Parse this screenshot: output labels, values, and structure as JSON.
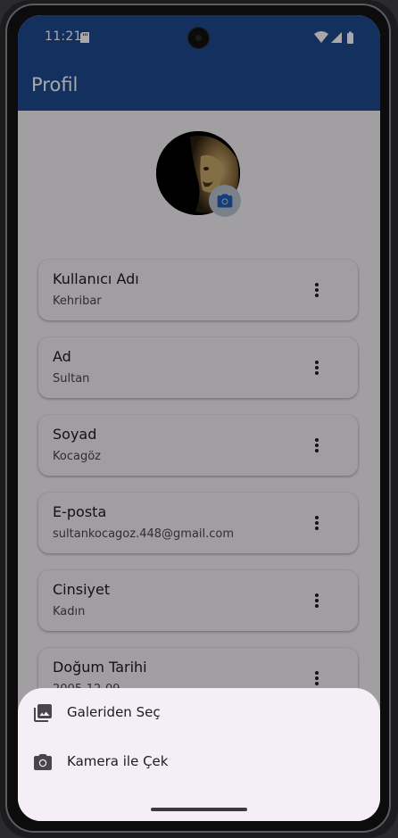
{
  "status_bar": {
    "time": "11:21",
    "icons": [
      "sd-card-icon",
      "wifi-icon",
      "signal-icon",
      "battery-icon"
    ]
  },
  "app_bar": {
    "title": "Profil"
  },
  "profile": {
    "avatar": "lion-photo",
    "camera_button_icon": "camera-icon"
  },
  "fields": [
    {
      "label": "Kullanıcı Adı",
      "value": "Kehribar"
    },
    {
      "label": "Ad",
      "value": "Sultan"
    },
    {
      "label": "Soyad",
      "value": "Kocagöz"
    },
    {
      "label": "E-posta",
      "value": "sultankocagoz.448@gmail.com"
    },
    {
      "label": "Cinsiyet",
      "value": "Kadın"
    },
    {
      "label": "Doğum Tarihi",
      "value": "2005-12-09"
    }
  ],
  "bottom_sheet": {
    "items": [
      {
        "label": "Galeriden Seç",
        "icon": "photo-library-icon"
      },
      {
        "label": "Kamera ile Çek",
        "icon": "camera-icon"
      }
    ]
  },
  "colors": {
    "app_bar": "#1f4a91",
    "background": "#f6f1f8",
    "card": "#f4eff7",
    "scrim": "rgba(0,0,0,0.34)"
  }
}
